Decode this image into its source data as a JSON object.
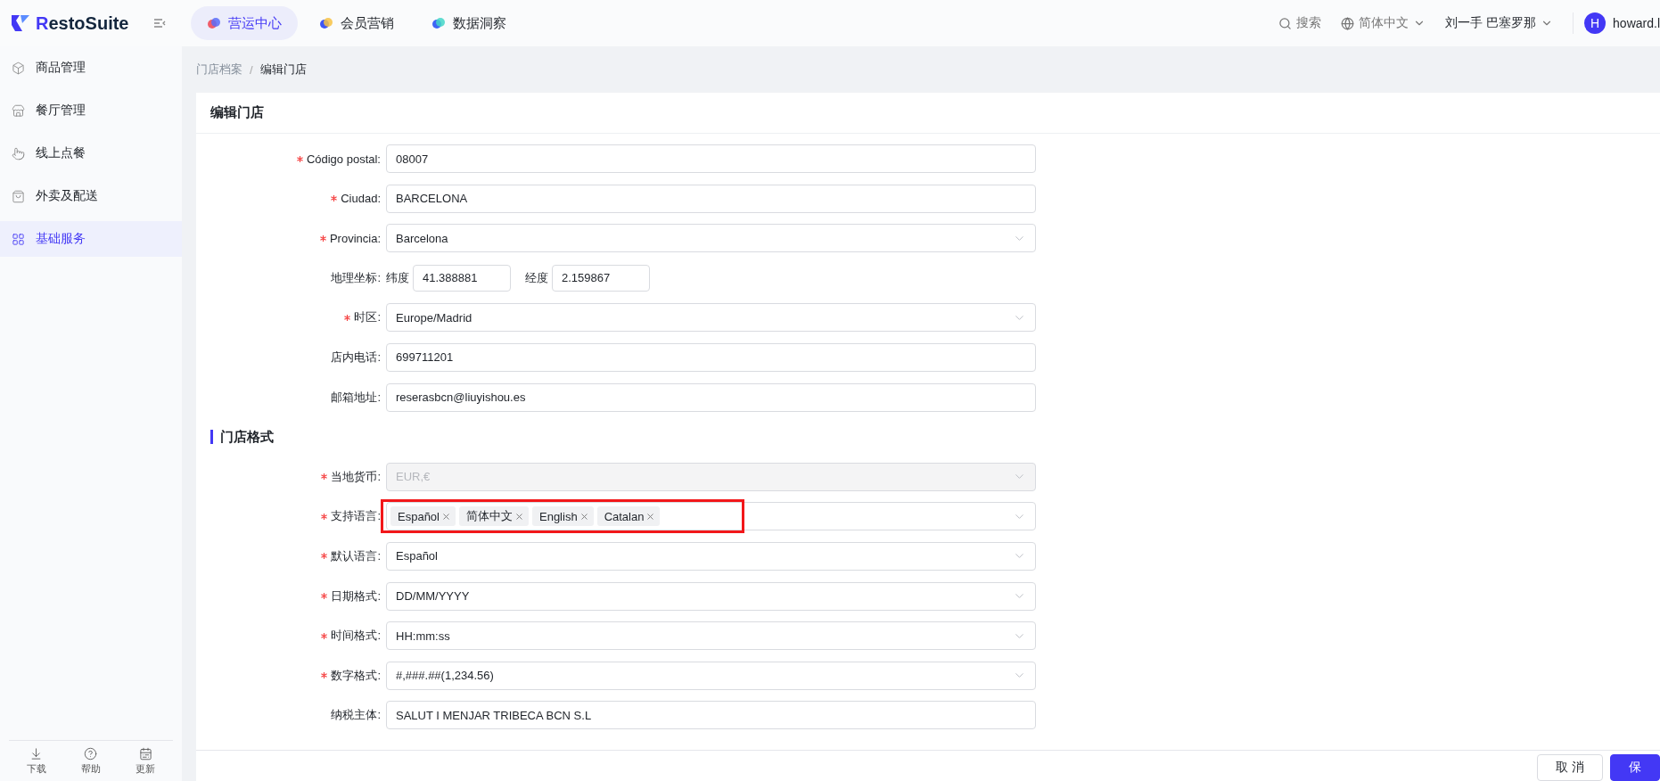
{
  "header": {
    "logo": "RestoSuite",
    "tabs": [
      {
        "label": "营运中心",
        "selected": true
      },
      {
        "label": "会员营销",
        "selected": false
      },
      {
        "label": "数据洞察",
        "selected": false
      }
    ],
    "search": "搜索",
    "language": "简体中文",
    "store": "刘一手 巴塞罗那",
    "user": {
      "initial": "H",
      "name": "howard.l"
    }
  },
  "sidebar": {
    "items": [
      {
        "label": "商品管理",
        "selected": false
      },
      {
        "label": "餐厅管理",
        "selected": false
      },
      {
        "label": "线上点餐",
        "selected": false
      },
      {
        "label": "外卖及配送",
        "selected": false
      },
      {
        "label": "基础服务",
        "selected": true
      }
    ],
    "footer": [
      "下载",
      "帮助",
      "更新"
    ]
  },
  "breadcrumb": {
    "items": [
      "门店档案",
      "编辑门店"
    ],
    "separator": "/"
  },
  "card": {
    "title": "编辑门店",
    "fields": [
      {
        "kind": "text",
        "label": "Código postal:",
        "required": true,
        "value": "08007"
      },
      {
        "kind": "text",
        "label": "Ciudad:",
        "required": true,
        "value": "BARCELONA"
      },
      {
        "kind": "select",
        "label": "Provincia:",
        "required": true,
        "value": "Barcelona"
      },
      {
        "kind": "coords",
        "label": "地理坐标:",
        "required": false,
        "parts": [
          {
            "label": "纬度",
            "value": "41.388881"
          },
          {
            "label": "经度",
            "value": "2.159867"
          }
        ]
      },
      {
        "kind": "select",
        "label": "时区:",
        "required": true,
        "value": "Europe/Madrid"
      },
      {
        "kind": "text",
        "label": "店内电话:",
        "required": false,
        "value": "699711201"
      },
      {
        "kind": "text",
        "label": "邮箱地址:",
        "required": false,
        "value": "reserasbcn@liuyishou.es"
      },
      {
        "kind": "section",
        "label": "门店格式"
      },
      {
        "kind": "select",
        "label": "当地货币:",
        "required": true,
        "value": "EUR,€",
        "disabled": true
      },
      {
        "kind": "tags",
        "label": "支持语言:",
        "required": true,
        "tags": [
          "Español",
          "简体中文",
          "English",
          "Catalan"
        ],
        "highlighted": true
      },
      {
        "kind": "select",
        "label": "默认语言:",
        "required": true,
        "value": "Español"
      },
      {
        "kind": "select",
        "label": "日期格式:",
        "required": true,
        "value": "DD/MM/YYYY"
      },
      {
        "kind": "select",
        "label": "时间格式:",
        "required": true,
        "value": "HH:mm:ss"
      },
      {
        "kind": "select",
        "label": "数字格式:",
        "required": true,
        "value": "#,###.##(1,234.56)"
      },
      {
        "kind": "text",
        "label": "纳税主体:",
        "required": false,
        "value": "SALUT I MENJAR TRIBECA BCN S.L"
      }
    ]
  },
  "footer": {
    "buttons": [
      {
        "label": "取消",
        "kind": "default"
      },
      {
        "label": "保",
        "kind": "primary"
      }
    ]
  }
}
